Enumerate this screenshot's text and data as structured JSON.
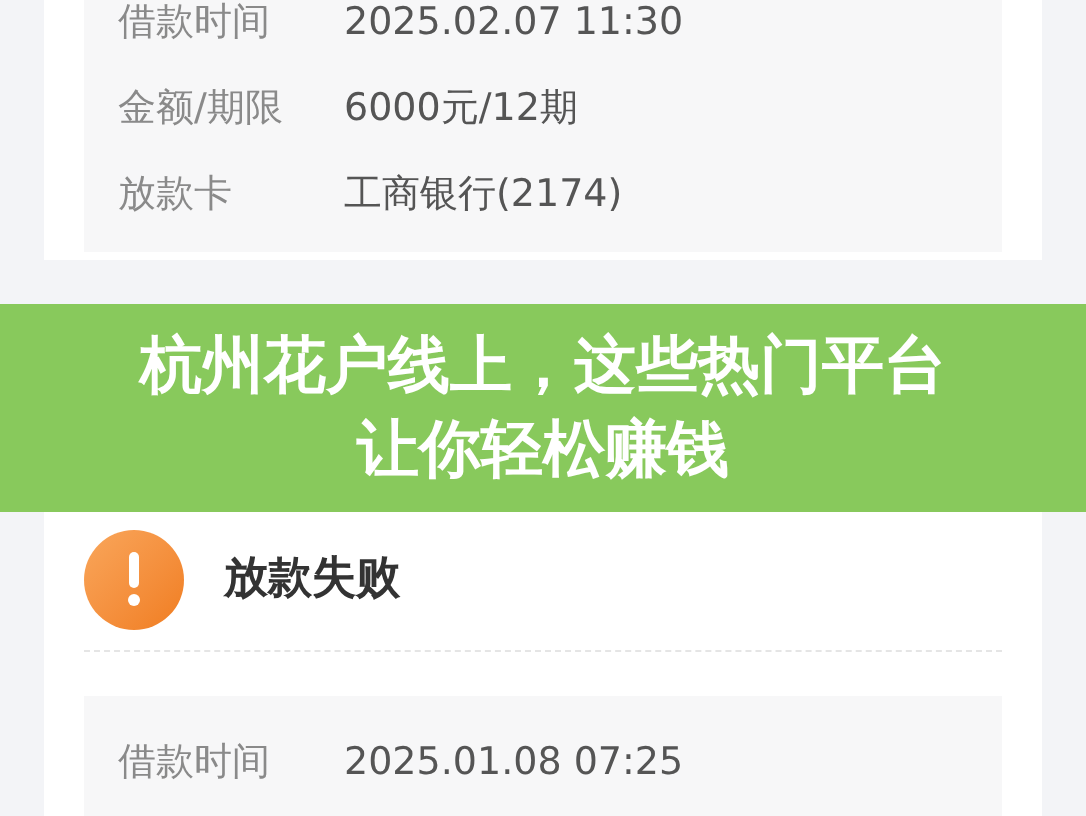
{
  "loan_card_top": {
    "rows": [
      {
        "label": "借款时间",
        "value": "2025.02.07 11:30"
      },
      {
        "label": "金额/期限",
        "value": "6000元/12期"
      },
      {
        "label": "放款卡",
        "value": "工商银行(2174)"
      }
    ]
  },
  "banner": {
    "lines": [
      "杭州花户线上，这些热门平台",
      "让你轻松赚钱"
    ]
  },
  "loan_card": {
    "status": "放款失败",
    "rows": [
      {
        "label": "借款时间",
        "value": "2025.01.08 07:25"
      }
    ]
  }
}
